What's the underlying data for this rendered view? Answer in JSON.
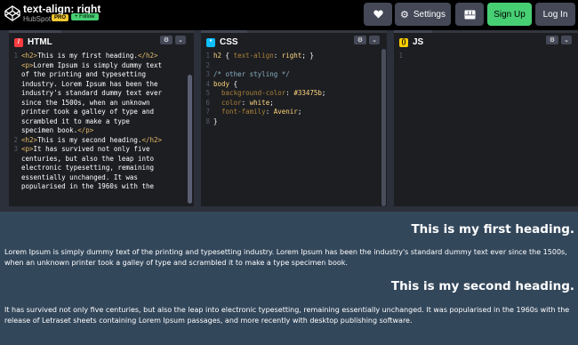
{
  "header": {
    "title": "text-align: right",
    "author": "HubSpot",
    "pro_badge": "PRO",
    "follow_label": "+ Follow",
    "heart_icon": "heart-icon",
    "settings_label": "Settings",
    "layout_icon": "layout-icon",
    "signup_label": "Sign Up",
    "login_label": "Log In"
  },
  "editors": {
    "html": {
      "label": "HTML",
      "line_numbers": [
        "1",
        "",
        "",
        "",
        "",
        "",
        "",
        "",
        "2",
        "3",
        "",
        "",
        "",
        ""
      ],
      "lines": [
        "<h2>This is my first heading.</h2>",
        "<p>Lorem Ipsum is simply dummy text",
        "of the printing and typesetting",
        "industry. Lorem Ipsum has been the",
        "industry's standard dummy text ever",
        "since the 1500s, when an unknown",
        "printer took a galley of type and",
        "scrambled it to make a type",
        "specimen book.</p>",
        "<h2>This is my second heading.</h2>",
        "<p>It has survived not only five",
        "centuries, but also the leap into",
        "electronic typesetting, remaining",
        "essentially unchanged. It was",
        "popularised in the 1960s with the"
      ]
    },
    "css": {
      "label": "CSS",
      "lines": [
        {
          "n": "1",
          "parts": [
            [
              "sel",
              "h2"
            ],
            [
              "plain",
              " { "
            ],
            [
              "prop",
              "text-align"
            ],
            [
              "plain",
              ": "
            ],
            [
              "val",
              "right"
            ],
            [
              "plain",
              "; }"
            ]
          ]
        },
        {
          "n": "2",
          "parts": []
        },
        {
          "n": "3",
          "parts": [
            [
              "cmt",
              "/* other styling */"
            ]
          ]
        },
        {
          "n": "4",
          "parts": [
            [
              "sel",
              "body"
            ],
            [
              "plain",
              " {"
            ]
          ]
        },
        {
          "n": "5",
          "parts": [
            [
              "plain",
              "  "
            ],
            [
              "prop",
              "background-color"
            ],
            [
              "plain",
              ": "
            ],
            [
              "val",
              "#33475b"
            ],
            [
              "plain",
              ";"
            ]
          ]
        },
        {
          "n": "6",
          "parts": [
            [
              "plain",
              "  "
            ],
            [
              "prop",
              "color"
            ],
            [
              "plain",
              ": "
            ],
            [
              "val",
              "white"
            ],
            [
              "plain",
              ";"
            ]
          ]
        },
        {
          "n": "7",
          "parts": [
            [
              "plain",
              "  "
            ],
            [
              "prop",
              "font-family"
            ],
            [
              "plain",
              ": "
            ],
            [
              "val",
              "Avenir"
            ],
            [
              "plain",
              ";"
            ]
          ]
        },
        {
          "n": "8",
          "parts": [
            [
              "plain",
              "}"
            ]
          ]
        }
      ]
    },
    "js": {
      "label": "JS",
      "line_numbers": [
        "1"
      ]
    }
  },
  "preview": {
    "heading1": "This is my first heading.",
    "paragraph1": "Lorem Ipsum is simply dummy text of the printing and typesetting industry. Lorem Ipsum has been the industry's standard dummy text ever since the 1500s, when an unknown printer took a galley of type and scrambled it to make a type specimen book.",
    "heading2": "This is my second heading.",
    "paragraph2": "It has survived not only five centuries, but also the leap into electronic typesetting, remaining essentially unchanged. It was popularised in the 1960s with the release of Letraset sheets containing Lorem Ipsum passages, and more recently with desktop publishing software."
  },
  "colors": {
    "preview_background": "#33475b",
    "signup": "#47cf73",
    "pro_badge": "#f3c832"
  }
}
